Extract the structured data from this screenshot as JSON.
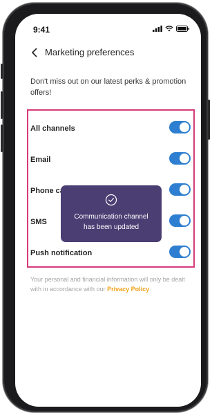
{
  "status": {
    "time": "9:41"
  },
  "header": {
    "title": "Marketing preferences"
  },
  "description": "Don't miss out on our latest perks & promotion offers!",
  "toggles": [
    {
      "label": "All channels",
      "on": true
    },
    {
      "label": "Email",
      "on": true
    },
    {
      "label": "Phone call",
      "on": true
    },
    {
      "label": "SMS",
      "on": true
    },
    {
      "label": "Push notification",
      "on": true
    }
  ],
  "footer": {
    "text": "Your personal and financial information will only be dealt with in accordance with our ",
    "link": "Privacy Policy",
    "end": "."
  },
  "toast": {
    "message": "Communication channel has been updated"
  },
  "colors": {
    "accent": "#2e7fd1",
    "highlight_border": "#d63a7a",
    "toast_bg": "#4a3e73",
    "link": "#f0a21a"
  }
}
